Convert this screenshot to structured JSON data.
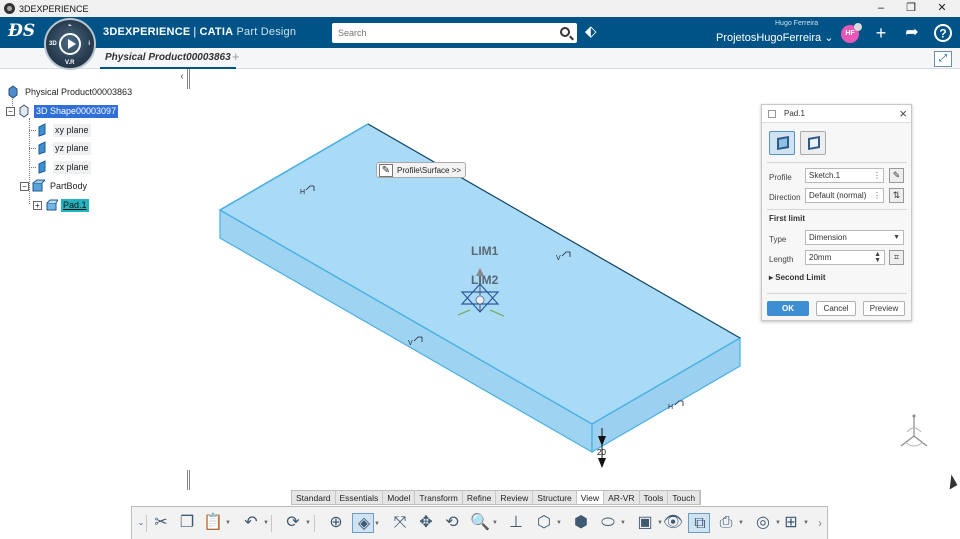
{
  "window": {
    "title": "3DEXPERIENCE",
    "minimize": "–",
    "restore": "❐",
    "close": "✕"
  },
  "header": {
    "brand_main": "3DEXPERIENCE",
    "brand_sep": "|",
    "brand_catia": "CATIA",
    "brand_app": "Part Design",
    "search_placeholder": "Search",
    "user_name": "Hugo Ferreira",
    "collab_space": "ProjetosHugoFerreira",
    "avatar_initials": "HF",
    "compass": {
      "v_r": "V.R",
      "label_3d": "3D",
      "i": "i",
      "share": "⌁"
    }
  },
  "tabs": {
    "doc_tab": "Physical Product00003863",
    "add_tab": "+",
    "collapse_tree": "‹"
  },
  "tree": {
    "root": "Physical Product00003863",
    "shape": "3D Shape00003097",
    "planes": [
      "xy plane",
      "yz plane",
      "zx plane"
    ],
    "body": "PartBody",
    "feature": "Pad.1",
    "expander_minus": "−",
    "expander_plus": "+"
  },
  "viewport": {
    "tooltip": "Profile\\Surface >>",
    "lim1": "LIM1",
    "lim2": "LIM2",
    "dimension_value": "20",
    "constraint_label": "V",
    "constraint_h": "H",
    "colors": {
      "pad_fill": "#a8d8f5",
      "pad_edge": "#4fb3e3",
      "pad_top": "#9fd3f2"
    }
  },
  "dialog": {
    "title": "Pad.1",
    "profile_label": "Profile",
    "profile_value": "Sketch.1",
    "direction_label": "Direction",
    "direction_value": "Default (normal)",
    "first_limit": "First limit",
    "type_label": "Type",
    "type_value": "Dimension",
    "length_label": "Length",
    "length_value": "20mm",
    "second_limit": "Second Limit",
    "ok": "OK",
    "cancel": "Cancel",
    "preview": "Preview"
  },
  "action_bar": {
    "sections": [
      "Standard",
      "Essentials",
      "Model",
      "Transform",
      "Refine",
      "Review",
      "Structure",
      "View",
      "AR-VR",
      "Tools",
      "Touch"
    ],
    "active_section": "View",
    "tools": [
      {
        "name": "cut-icon",
        "glyph": "✂"
      },
      {
        "name": "copy-icon",
        "glyph": "❐"
      },
      {
        "name": "paste-icon",
        "glyph": "📋"
      },
      {
        "name": "undo-icon",
        "glyph": "↶"
      },
      {
        "name": "update-icon",
        "glyph": "⟳"
      },
      {
        "name": "zoom-area-icon",
        "glyph": "⊕"
      },
      {
        "name": "render-mode-icon",
        "glyph": "◈"
      },
      {
        "name": "fit-all-icon",
        "glyph": "⤧"
      },
      {
        "name": "pan-icon",
        "glyph": "✥"
      },
      {
        "name": "rotate-icon",
        "glyph": "⟲"
      },
      {
        "name": "zoom-icon",
        "glyph": "🔍"
      },
      {
        "name": "normal-view-icon",
        "glyph": "⊥"
      },
      {
        "name": "iso-view-icon",
        "glyph": "⬡"
      },
      {
        "name": "shading-icon",
        "glyph": "⬢"
      },
      {
        "name": "cylinder-icon",
        "glyph": "⬭"
      },
      {
        "name": "display-options-icon",
        "glyph": "▣"
      },
      {
        "name": "hide-show-icon",
        "glyph": "👁"
      },
      {
        "name": "swap-visible-icon",
        "glyph": "⧉"
      },
      {
        "name": "capture-icon",
        "glyph": "⎙"
      },
      {
        "name": "measure-icon",
        "glyph": "◎"
      },
      {
        "name": "layout-icon",
        "glyph": "⊞"
      }
    ],
    "more": "›"
  }
}
